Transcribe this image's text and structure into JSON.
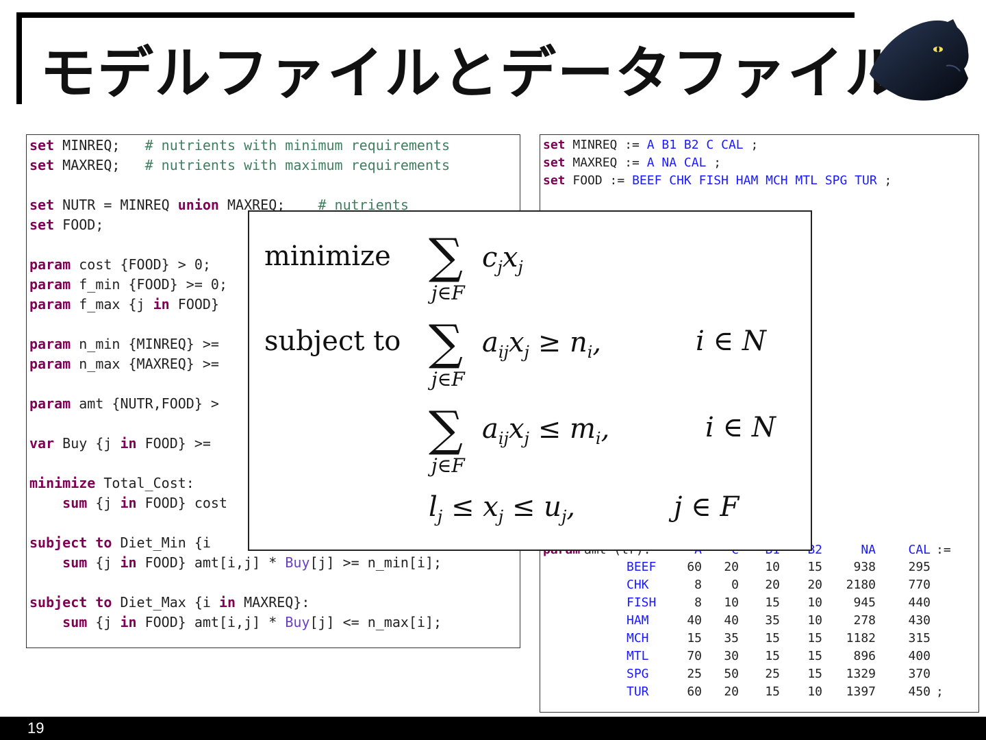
{
  "slide": {
    "title": "モデルファイルとデータファイル",
    "page_number": "19",
    "logo_icon": "black-panther-logo"
  },
  "model_code": {
    "lines": [
      [
        {
          "t": "set",
          "c": "kw"
        },
        {
          "t": " MINREQ;   "
        },
        {
          "t": "# nutrients with minimum requirements",
          "c": "cm"
        }
      ],
      [
        {
          "t": "set",
          "c": "kw"
        },
        {
          "t": " MAXREQ;   "
        },
        {
          "t": "# nutrients with maximum requirements",
          "c": "cm"
        }
      ],
      [],
      [
        {
          "t": "set",
          "c": "kw"
        },
        {
          "t": " NUTR = MINREQ "
        },
        {
          "t": "union",
          "c": "kw"
        },
        {
          "t": " MAXREQ;    "
        },
        {
          "t": "# nutrients",
          "c": "cm"
        }
      ],
      [
        {
          "t": "set",
          "c": "kw"
        },
        {
          "t": " FOOD;"
        }
      ],
      [],
      [
        {
          "t": "param",
          "c": "kw"
        },
        {
          "t": " cost {FOOD} > 0;"
        }
      ],
      [
        {
          "t": "param",
          "c": "kw"
        },
        {
          "t": " f_min {FOOD} >= 0;"
        }
      ],
      [
        {
          "t": "param",
          "c": "kw"
        },
        {
          "t": " f_max {j "
        },
        {
          "t": "in",
          "c": "kw"
        },
        {
          "t": " FOOD}"
        }
      ],
      [],
      [
        {
          "t": "param",
          "c": "kw"
        },
        {
          "t": " n_min {MINREQ} >="
        }
      ],
      [
        {
          "t": "param",
          "c": "kw"
        },
        {
          "t": " n_max {MAXREQ} >="
        }
      ],
      [],
      [
        {
          "t": "param",
          "c": "kw"
        },
        {
          "t": " amt {NUTR,FOOD} >"
        }
      ],
      [],
      [
        {
          "t": "var",
          "c": "kw"
        },
        {
          "t": " Buy {j "
        },
        {
          "t": "in",
          "c": "kw"
        },
        {
          "t": " FOOD} >= "
        }
      ],
      [],
      [
        {
          "t": "minimize",
          "c": "kw"
        },
        {
          "t": " Total_Cost:"
        }
      ],
      [
        {
          "t": "    "
        },
        {
          "t": "sum",
          "c": "kw"
        },
        {
          "t": " {j "
        },
        {
          "t": "in",
          "c": "kw"
        },
        {
          "t": " FOOD} cost"
        }
      ],
      [],
      [
        {
          "t": "subject to",
          "c": "kw"
        },
        {
          "t": " Diet_Min {i "
        }
      ],
      [
        {
          "t": "    "
        },
        {
          "t": "sum",
          "c": "kw"
        },
        {
          "t": " {j "
        },
        {
          "t": "in",
          "c": "kw"
        },
        {
          "t": " FOOD} amt[i,j] * "
        },
        {
          "t": "Buy",
          "c": "bu"
        },
        {
          "t": "[j] >= n_min[i];"
        }
      ],
      [],
      [
        {
          "t": "subject to",
          "c": "kw"
        },
        {
          "t": " Diet_Max {i "
        },
        {
          "t": "in",
          "c": "kw"
        },
        {
          "t": " MAXREQ}:"
        }
      ],
      [
        {
          "t": "    "
        },
        {
          "t": "sum",
          "c": "kw"
        },
        {
          "t": " {j "
        },
        {
          "t": "in",
          "c": "kw"
        },
        {
          "t": " FOOD} amt[i,j] * "
        },
        {
          "t": "Buy",
          "c": "bu"
        },
        {
          "t": "[j] <= n_max[i];"
        }
      ]
    ]
  },
  "data_code": {
    "set_lines": [
      [
        {
          "t": "set",
          "c": "kw"
        },
        {
          "t": " MINREQ := "
        },
        {
          "t": "A B1 B2 C CAL",
          "c": "dv"
        },
        {
          "t": " ;"
        }
      ],
      [
        {
          "t": "set",
          "c": "kw"
        },
        {
          "t": " MAXREQ := "
        },
        {
          "t": "A NA CAL",
          "c": "dv"
        },
        {
          "t": " ;"
        }
      ],
      [
        {
          "t": "set",
          "c": "kw"
        },
        {
          "t": " FOOD := "
        },
        {
          "t": "BEEF CHK FISH HAM MCH MTL SPG TUR",
          "c": "dv"
        },
        {
          "t": " ;"
        }
      ]
    ],
    "amt_header_prefix": "param amt (tr):",
    "amt_columns": [
      "A",
      "C",
      "B1",
      "B2",
      "NA",
      "CAL"
    ],
    "amt_assign": ":=",
    "amt_rows": [
      {
        "food": "BEEF",
        "values": [
          "60",
          "20",
          "10",
          "15",
          "938",
          "295"
        ]
      },
      {
        "food": "CHK",
        "values": [
          "8",
          "0",
          "20",
          "20",
          "2180",
          "770"
        ]
      },
      {
        "food": "FISH",
        "values": [
          "8",
          "10",
          "15",
          "10",
          "945",
          "440"
        ]
      },
      {
        "food": "HAM",
        "values": [
          "40",
          "40",
          "35",
          "10",
          "278",
          "430"
        ]
      },
      {
        "food": "MCH",
        "values": [
          "15",
          "35",
          "15",
          "15",
          "1182",
          "315"
        ]
      },
      {
        "food": "MTL",
        "values": [
          "70",
          "30",
          "15",
          "15",
          "896",
          "400"
        ]
      },
      {
        "food": "SPG",
        "values": [
          "25",
          "50",
          "25",
          "15",
          "1329",
          "370"
        ]
      },
      {
        "food": "TUR",
        "values": [
          "60",
          "20",
          "15",
          "10",
          "1397",
          "450"
        ]
      }
    ],
    "amt_end": ";"
  },
  "formula": {
    "minimize_label": "minimize",
    "subject_label": "subject to",
    "sum_symbol": "∑",
    "sum_index": "j∈F",
    "objective": "c",
    "objective_sub": "j",
    "objective_var": "x",
    "c1_expr": "a",
    "c1_rel": "≥ n",
    "c1_cond": "i ∈ N",
    "c2_rel": "≤ m",
    "c2_cond": "i ∈ N",
    "c3_expr": "l",
    "c3_cond": "j ∈ F"
  }
}
